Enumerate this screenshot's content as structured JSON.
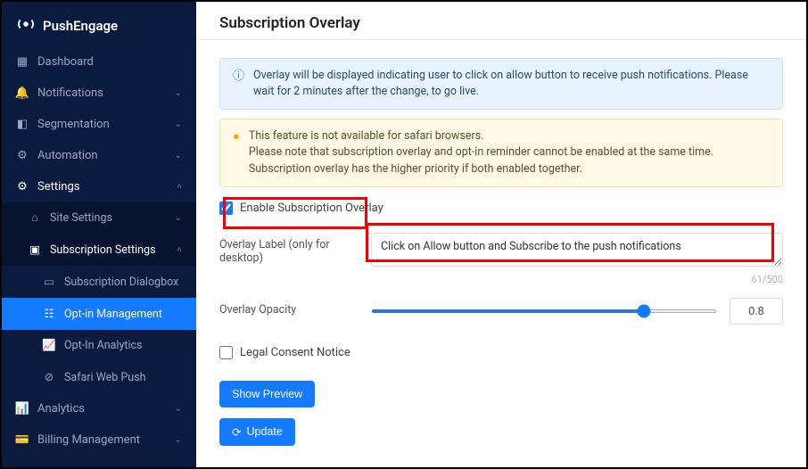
{
  "brand": "PushEngage",
  "sidebar": {
    "items": [
      {
        "icon": "dashboard-icon",
        "label": "Dashboard"
      },
      {
        "icon": "bell-icon",
        "label": "Notifications"
      },
      {
        "icon": "segment-icon",
        "label": "Segmentation"
      },
      {
        "icon": "automation-icon",
        "label": "Automation"
      },
      {
        "icon": "gear-icon",
        "label": "Settings"
      },
      {
        "icon": "analytics-icon",
        "label": "Analytics"
      },
      {
        "icon": "billing-icon",
        "label": "Billing Management"
      }
    ],
    "settings_sub": [
      {
        "icon": "site-icon",
        "label": "Site Settings"
      },
      {
        "icon": "subscription-icon",
        "label": "Subscription Settings"
      }
    ],
    "subscription_sub": [
      {
        "icon": "dialog-icon",
        "label": "Subscription Dialogbox"
      },
      {
        "icon": "optin-icon",
        "label": "Opt-in Management"
      },
      {
        "icon": "analytics2-icon",
        "label": "Opt-In Analytics"
      },
      {
        "icon": "safari-icon",
        "label": "Safari Web Push"
      }
    ]
  },
  "page": {
    "title": "Subscription Overlay",
    "alert_info": "Overlay will be displayed indicating user to click on allow button to receive push notifications. Please wait for 2 minutes after the change, to go live.",
    "alert_warn": "This feature is not available for safari browsers.\nPlease note that subscription overlay and opt-in reminder cannot be enabled at the same time. Subscription overlay has the higher priority if both enabled together.",
    "enable_label": "Enable Subscription Overlay",
    "overlay_label_caption": "Overlay Label (only for desktop)",
    "overlay_label_value": "Click on Allow button and Subscribe to the push notifications",
    "char_counter": "61/500",
    "opacity_label": "Overlay Opacity",
    "opacity_value": "0.8",
    "legal_label": "Legal Consent Notice",
    "show_preview": "Show Preview",
    "update": "Update"
  }
}
